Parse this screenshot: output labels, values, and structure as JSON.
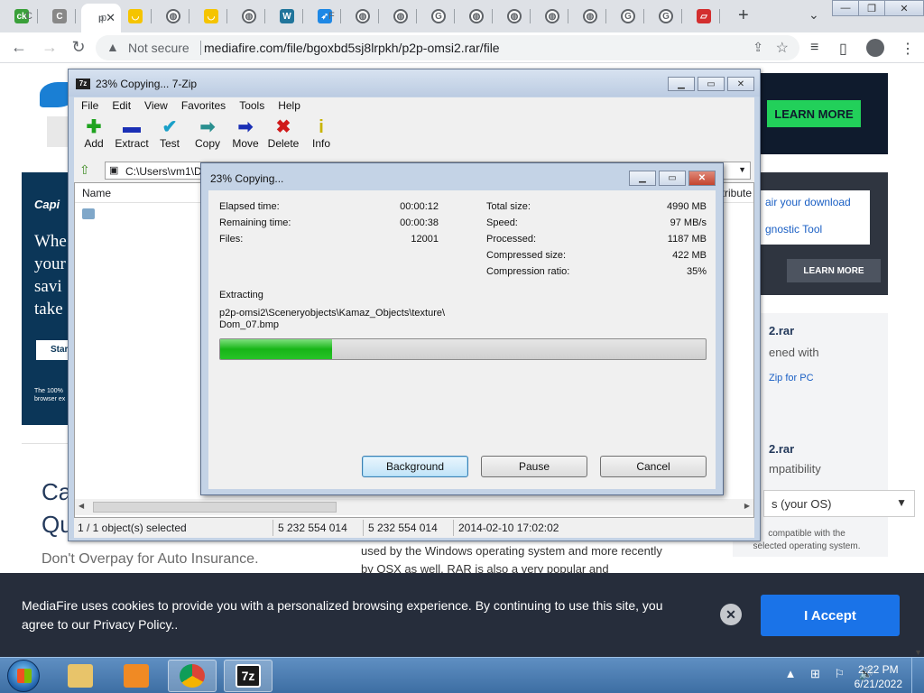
{
  "browser": {
    "tabs": [
      {
        "favicon": "ck-icon",
        "mini": "C"
      },
      {
        "favicon": "c-icon",
        "mini": ""
      },
      {
        "favicon": "p-icon",
        "mini": "p",
        "close": "✕"
      },
      {
        "favicon": "smiley-icon",
        "mini": ""
      },
      {
        "favicon": "globe-icon",
        "mini": ""
      },
      {
        "favicon": "smiley-icon",
        "mini": ""
      },
      {
        "favicon": "globe-icon",
        "mini": ""
      },
      {
        "favicon": "wordpress-icon",
        "mini": ""
      },
      {
        "favicon": "bird-icon",
        "mini": "F"
      },
      {
        "favicon": "globe-icon",
        "mini": ""
      },
      {
        "favicon": "globe-icon",
        "mini": ""
      },
      {
        "favicon": "google-icon",
        "mini": ""
      },
      {
        "favicon": "globe-icon",
        "mini": ""
      },
      {
        "favicon": "globe-icon",
        "mini": ""
      },
      {
        "favicon": "globe-icon",
        "mini": ""
      },
      {
        "favicon": "globe-icon",
        "mini": ""
      },
      {
        "favicon": "google-icon",
        "mini": ""
      },
      {
        "favicon": "google-icon",
        "mini": ""
      },
      {
        "favicon": "red-doc-icon",
        "mini": ""
      }
    ],
    "new_tab": "+",
    "not_secure": "Not secure",
    "url": "mediafire.com/file/bgoxbd5sj8lrpkh/p2p-omsi2.rar/file"
  },
  "page": {
    "cap_brand": "Capi",
    "cap_lines": "Whe\nyour\nsavi\ntake",
    "cap_start": "Star",
    "cap_fine": "The 100%\nbrowser ex",
    "ca_title": "Ca\nQu",
    "ca_sub": "Don't Overpay for Auto Insurance.",
    "article": "used by the Windows operating system and more recently by OSX as well. RAR is also a very popular and",
    "learn_more_green": "LEARN MORE",
    "repair_link": "air your download",
    "diag_link": "gnostic Tool",
    "learn_more_dark": "LEARN MORE",
    "info_h1": "2.rar",
    "info_p1": "ened with",
    "info_link": "Zip for PC",
    "info_h2": "2.rar",
    "info_p2": "mpatibility",
    "os_select": "s (your OS)",
    "info_small": "compatible with the\nselected operating system."
  },
  "cookie": {
    "message": "MediaFire uses cookies to provide you with a personalized browsing experience. By continuing to use this site, you agree to our Privacy Policy..",
    "accept": "I Accept"
  },
  "zip": {
    "title": "23% Copying... 7-Zip",
    "menu": [
      "File",
      "Edit",
      "View",
      "Favorites",
      "Tools",
      "Help"
    ],
    "tools": [
      {
        "label": "Add",
        "icon": "add-icon",
        "glyph": "✚",
        "color": "#1fa31f"
      },
      {
        "label": "Extract",
        "icon": "extract-icon",
        "glyph": "▬",
        "color": "#1a2fb5"
      },
      {
        "label": "Test",
        "icon": "test-icon",
        "glyph": "✔",
        "color": "#1aa0c8"
      },
      {
        "label": "Copy",
        "icon": "copy-icon",
        "glyph": "➡",
        "color": "#2a8f8f"
      },
      {
        "label": "Move",
        "icon": "move-icon",
        "glyph": "➡",
        "color": "#1a2fb5"
      },
      {
        "label": "Delete",
        "icon": "delete-icon",
        "glyph": "✖",
        "color": "#d01a1a"
      },
      {
        "label": "Info",
        "icon": "info-icon",
        "glyph": "i",
        "color": "#c8b400"
      }
    ],
    "path": "C:\\Users\\vm1\\D",
    "col_name": "Name",
    "col_right": "ttribute",
    "status": {
      "selected": "1 / 1 object(s) selected",
      "size": "5 232 554 014",
      "packed": "5 232 554 014",
      "date": "2014-02-10 17:02:02"
    }
  },
  "dialog": {
    "title": "23% Copying...",
    "progress": 0.23,
    "left": [
      {
        "label": "Elapsed time:",
        "value": "00:00:12"
      },
      {
        "label": "Remaining time:",
        "value": "00:00:38"
      },
      {
        "label": "Files:",
        "value": "12001"
      }
    ],
    "right": [
      {
        "label": "Total size:",
        "value": "4990 MB"
      },
      {
        "label": "Speed:",
        "value": "97 MB/s"
      },
      {
        "label": "Processed:",
        "value": "1187 MB"
      },
      {
        "label": "Compressed size:",
        "value": "422 MB"
      },
      {
        "label": "Compression ratio:",
        "value": "35%"
      }
    ],
    "operation": "Extracting",
    "file_line1": "p2p-omsi2\\Sceneryobjects\\Kamaz_Objects\\texture\\",
    "file_line2": "Dom_07.bmp",
    "buttons": {
      "background": "Background",
      "pause": "Pause",
      "cancel": "Cancel"
    }
  },
  "taskbar": {
    "items": [
      {
        "name": "explorer-icon",
        "color": "#e8c46a"
      },
      {
        "name": "media-player-icon",
        "color": "#f08a24"
      },
      {
        "name": "chrome-icon",
        "color": "#db4437"
      },
      {
        "name": "7zip-icon",
        "color": "#1a1a1a"
      }
    ],
    "tray": "▲ ⊞ ⚐ 🔊",
    "time": "2:22 PM",
    "date": "6/21/2022"
  }
}
